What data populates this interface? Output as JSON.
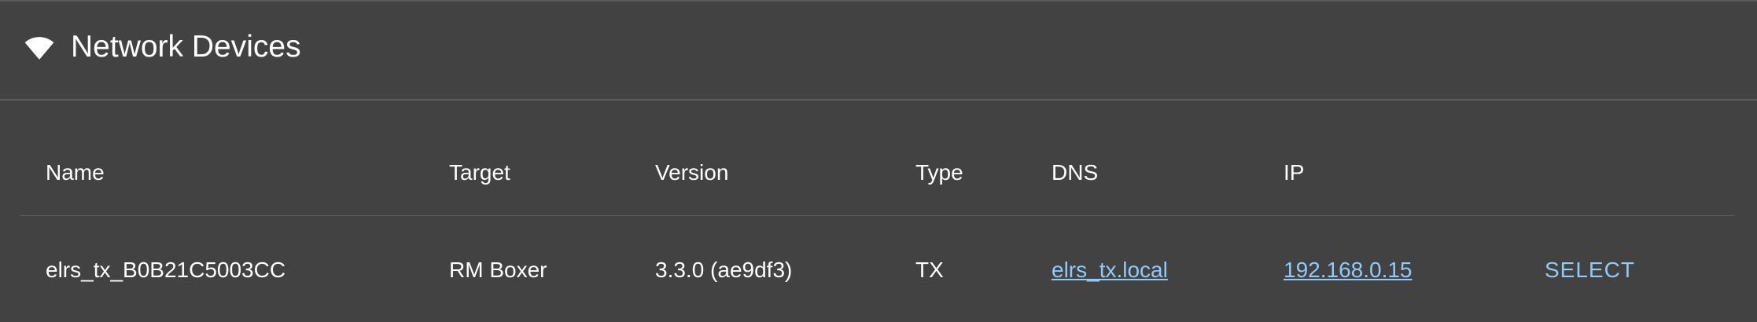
{
  "panel": {
    "title": "Network Devices",
    "icon": "wifi-icon"
  },
  "table": {
    "columns": [
      "Name",
      "Target",
      "Version",
      "Type",
      "DNS",
      "IP"
    ],
    "rows": [
      {
        "name": "elrs_tx_B0B21C5003CC",
        "target": "RM Boxer",
        "version": "3.3.0 (ae9df3)",
        "type": "TX",
        "dns": "elrs_tx.local",
        "ip": "192.168.0.15",
        "action": "SELECT"
      }
    ]
  },
  "colors": {
    "background": "#424242",
    "text": "#ffffff",
    "link": "#90caf9",
    "divider": "#5a5a5a"
  }
}
